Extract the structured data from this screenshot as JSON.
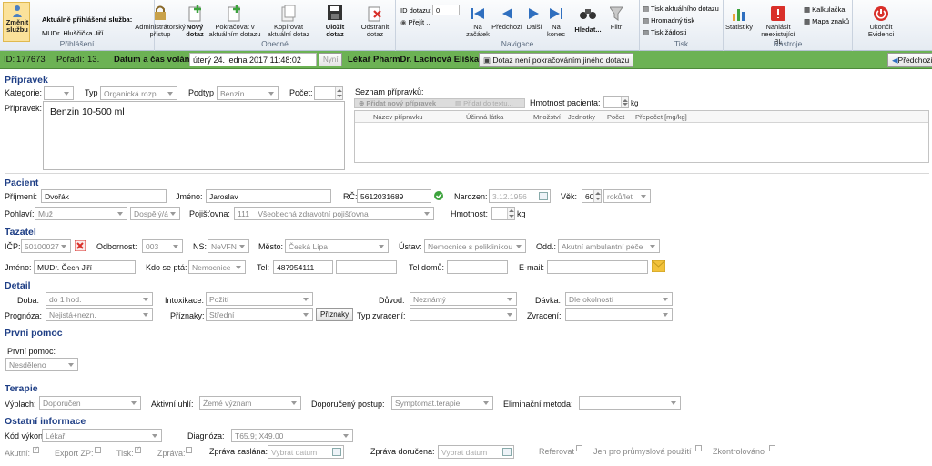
{
  "ribbon": {
    "change_service": "Změnit službu",
    "logged_service_title": "Aktuálně přihlášená služba:",
    "logged_service_user": "MUDr. Hluščička Jiří",
    "group_login": "Přihlášení",
    "admin_access": "Administrátorský přístup",
    "new_query": "Nový dotaz",
    "continue_query": "Pokračovat v aktuálním dotazu",
    "copy_query": "Kopírovat aktuální dotaz",
    "save_query": "Uložit dotaz",
    "delete_query": "Odstranit dotaz",
    "group_general": "Obecné",
    "query_id_label": "ID dotazu:",
    "query_id_value": "0",
    "goto": "Přejít ...",
    "nav_start": "Na začátek",
    "nav_prev": "Předchozí",
    "nav_next": "Další",
    "nav_end": "Na konec",
    "search": "Hledat...",
    "group_navigation": "Navigace",
    "filter": "Filtr",
    "print_current": "Tisk aktuálního dotazu",
    "print_bulk": "Hromadný tisk",
    "print_request": "Tisk žádosti",
    "group_print": "Tisk",
    "statistics": "Statistiky",
    "report_missing": "Nahlásit neexistující BL",
    "calculator": "Kalkulačka",
    "char_map": "Mapa znaků",
    "group_tools": "Nástroje",
    "exit": "Ukončit Evidenci"
  },
  "status": {
    "id_label": "ID:",
    "id_value": "177673",
    "order_label": "Pořadí:",
    "order_value": "13.",
    "datetime_label": "Datum a čas volání:",
    "datetime_value": "úterý 24. ledna 2017 11:48:02",
    "now_button": "Nyní",
    "doctor": "Lékař PharmDr. Lacinová Eliška",
    "not_continued": "Dotaz není pokračováním jiného dotazu",
    "previous": "Předchozí"
  },
  "preparation": {
    "title": "Přípravek",
    "category_label": "Kategorie:",
    "category_value": "",
    "type_label": "Typ",
    "type_value": "Organická rozp.",
    "subtype_label": "Podtyp",
    "subtype_value": "Benzín",
    "count_label": "Počet:",
    "count_value": "",
    "prep_label": "Přípravek:",
    "prep_value": "Benzin 10-500 ml",
    "list_label": "Seznam přípravků:",
    "add_new": "Přidat nový přípravek",
    "add_to_text": "Přidat do textu...",
    "weight_label": "Hmotnost pacienta:",
    "weight_value": "",
    "weight_unit": "kg",
    "columns": [
      "Název přípravku",
      "Účinná látka",
      "Množství",
      "Jednotky",
      "Počet",
      "Přepočet [mg/kg]"
    ]
  },
  "patient": {
    "title": "Pacient",
    "surname_label": "Příjmení:",
    "surname": "Dvořák",
    "name_label": "Jméno:",
    "name": "Jaroslav",
    "rc_label": "RČ:",
    "rc": "5612031689",
    "born_label": "Narozen:",
    "born": "3.12.1956",
    "age_label": "Věk:",
    "age": "60",
    "age_unit": "roků/let",
    "sex_label": "Pohlaví:",
    "sex": "Muž",
    "age_group": "Dospělý/á",
    "insurance_label": "Pojišťovna:",
    "insurance_code": "111",
    "insurance_name": "Všeobecná zdravotní pojišťovna",
    "weight_label": "Hmotnost:",
    "weight_unit": "kg"
  },
  "caller": {
    "title": "Tazatel",
    "icp_label": "IČP:",
    "icp": "50100027",
    "expertise_label": "Odbornost:",
    "expertise": "003",
    "ns_label": "NS:",
    "ns": "NeVFN",
    "city_label": "Město:",
    "city": "Česká Lípa",
    "institution_label": "Ústav:",
    "institution": "Nemocnice s poliklinikou",
    "department_label": "Odd.:",
    "department": "Akutní ambulantní péče",
    "name_label": "Jméno:",
    "name": "MUDr. Čech Jiří",
    "from_where_label": "Kdo se ptá:",
    "from_where": "Nemocnice",
    "tel_label": "Tel:",
    "tel": "487954111",
    "tel_home_label": "Tel domů:",
    "email_label": "E-mail:"
  },
  "detail": {
    "title": "Detail",
    "time_label": "Doba:",
    "time": "do 1 hod.",
    "intox_label": "Intoxikace:",
    "intox": "Požití",
    "reason_label": "Důvod:",
    "reason": "Neznámý",
    "dose_label": "Dávka:",
    "dose": "Dle okolností",
    "prognosis_label": "Prognóza:",
    "prognosis": "Nejistá+nezn.",
    "symptoms_label": "Příznaky:",
    "symptoms": "Střední",
    "symptoms_button": "Příznaky",
    "vomit_type_label": "Typ zvracení:",
    "vomit_label": "Zvracení:"
  },
  "first_aid": {
    "title": "První pomoc",
    "label": "První pomoc:",
    "value": "Nesděleno"
  },
  "therapy": {
    "title": "Terapie",
    "lavage_label": "Výplach:",
    "lavage": "Doporučen",
    "charcoal_label": "Aktivní uhlí:",
    "charcoal": "Žemé význam",
    "recommended_label": "Doporučený postup:",
    "recommended": "Symptomat.terapie",
    "elimination_label": "Eliminační metoda:"
  },
  "other": {
    "title": "Ostatní informace",
    "code_label": "Kód výkonu:",
    "code": "Lékař",
    "diagnosis_label": "Diagnóza:",
    "diagnosis": "T65.9; X49.00",
    "acute_label": "Akutní:",
    "export_label": "Export ZP:",
    "print_label": "Tisk:",
    "report_label": "Zpráva:",
    "sent_label": "Zpráva zaslána:",
    "sent_placeholder": "Vybrat datum",
    "received_label": "Zpráva doručena:",
    "received_placeholder": "Vybrat datum",
    "referral_label": "Referovat",
    "industrial_label": "Jen pro průmyslová použití",
    "checked_label": "Zkontrolováno"
  },
  "colors": {
    "status_green": "#6cb254",
    "section_blue": "#1f3f86",
    "accent_red": "#d9302a"
  },
  "icons": [
    "change-service-icon",
    "lock-icon",
    "new-query-icon",
    "continue-query-icon",
    "copy-query-icon",
    "save-icon",
    "delete-icon",
    "first-icon",
    "prev-icon",
    "next-icon",
    "last-icon",
    "binoculars-icon",
    "filter-icon",
    "printer-icon",
    "statistics-icon",
    "report-icon",
    "calculator-icon",
    "charmap-icon",
    "exit-icon"
  ]
}
